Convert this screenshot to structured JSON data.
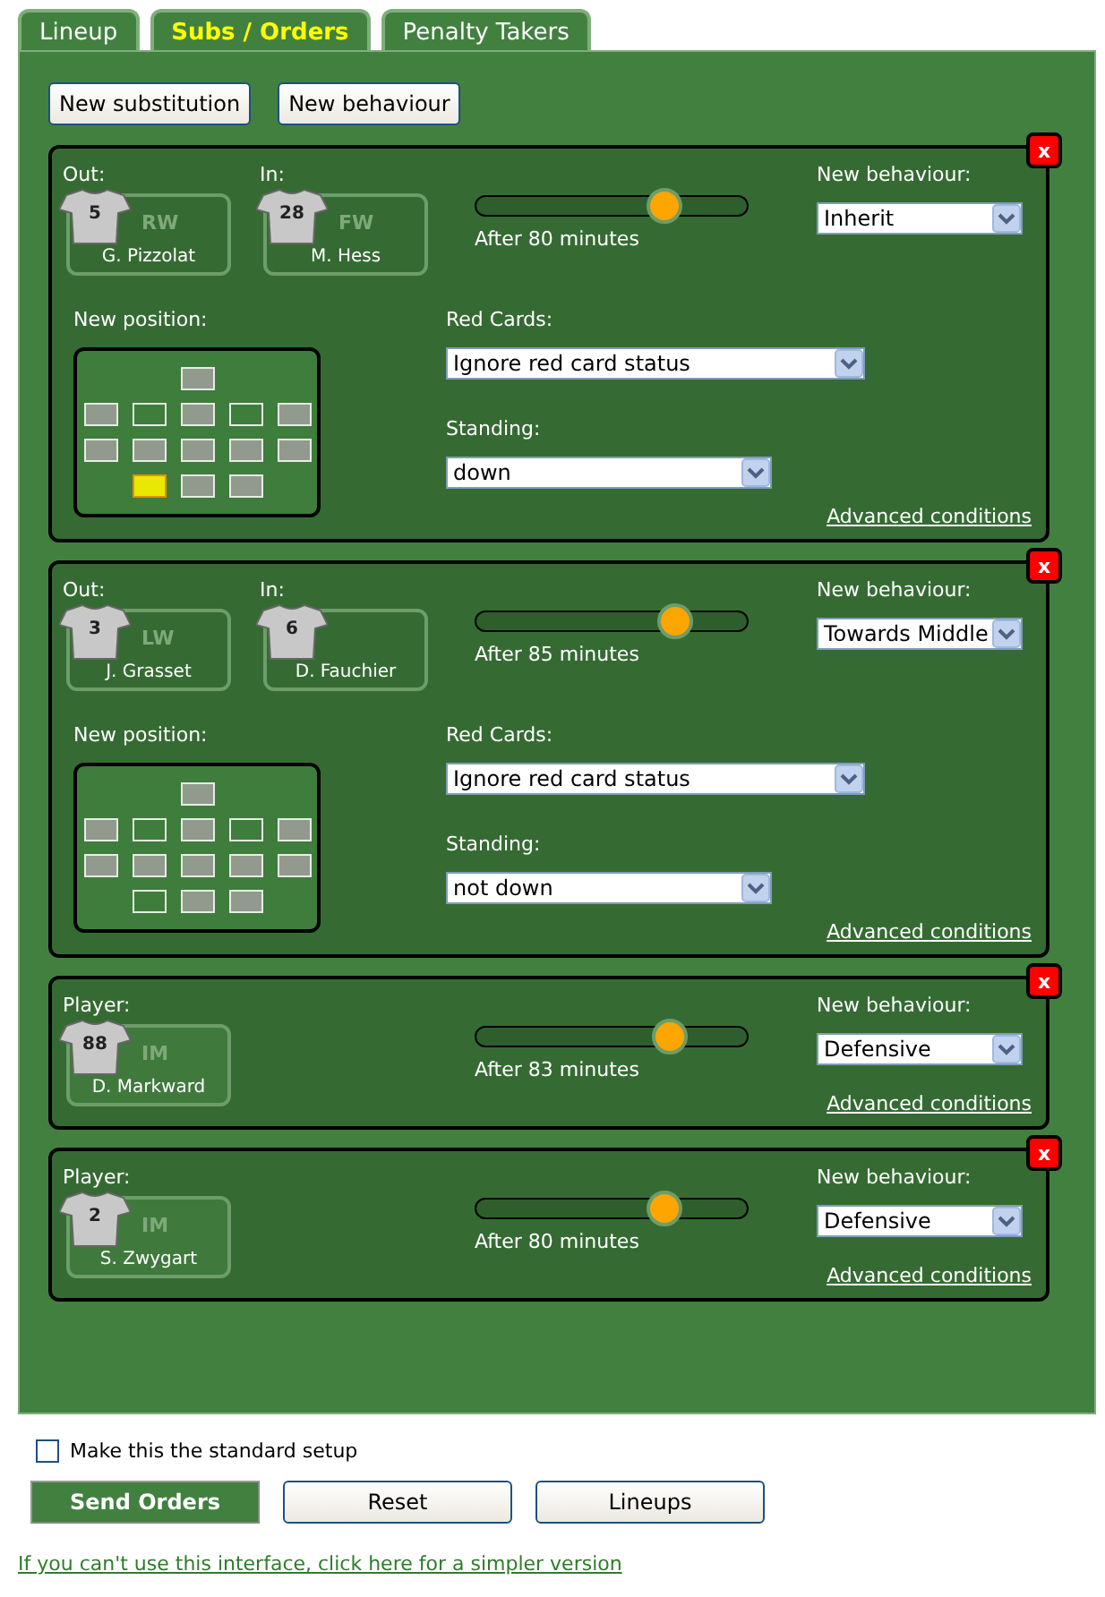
{
  "tabs": [
    {
      "label": "Lineup",
      "selected": false
    },
    {
      "label": "Subs / Orders",
      "selected": true
    },
    {
      "label": "Penalty Takers",
      "selected": false
    }
  ],
  "actions": [
    "New substitution",
    "New behaviour"
  ],
  "orders": [
    {
      "kind": "substitution",
      "out_label": "Out:",
      "in_label": "In:",
      "out": {
        "number": "5",
        "position": "RW",
        "name": "G. Pizzolat"
      },
      "in": {
        "number": "28",
        "position": "FW",
        "name": "M. Hess"
      },
      "level": 0.69,
      "minutes": "After 80 minutes",
      "behaviour_label": "New behaviour:",
      "behaviour": "Inherit",
      "position_label": "New position:",
      "formation": [
        [
          {
            "occupied": true,
            "selected": false
          }
        ],
        [
          {
            "occupied": true,
            "selected": false
          },
          {
            "occupied": false,
            "selected": false
          },
          {
            "occupied": true,
            "selected": false
          },
          {
            "occupied": false,
            "selected": false
          },
          {
            "occupied": true,
            "selected": false
          }
        ],
        [
          {
            "occupied": true,
            "selected": false
          },
          {
            "occupied": true,
            "selected": false
          },
          {
            "occupied": true,
            "selected": false
          },
          {
            "occupied": true,
            "selected": false
          },
          {
            "occupied": true,
            "selected": false
          }
        ],
        [
          {
            "occupied": true,
            "selected": true
          },
          {
            "occupied": true,
            "selected": false
          },
          {
            "occupied": true,
            "selected": false
          }
        ]
      ],
      "red_cards_label": "Red Cards:",
      "red_cards": "Ignore red card status",
      "standing_label": "Standing:",
      "standing": "down",
      "advanced": "Advanced conditions",
      "close": "x"
    },
    {
      "kind": "substitution",
      "out_label": "Out:",
      "in_label": "In:",
      "out": {
        "number": "3",
        "position": "LW",
        "name": "J. Grasset"
      },
      "in": {
        "number": "6",
        "name": "D. Fauchier"
      },
      "level": 0.73,
      "minutes": "After 85 minutes",
      "behaviour_label": "New behaviour:",
      "behaviour": "Towards Middle",
      "position_label": "New position:",
      "formation": [
        [
          {
            "occupied": true,
            "selected": false
          }
        ],
        [
          {
            "occupied": true,
            "selected": false
          },
          {
            "occupied": false,
            "selected": false
          },
          {
            "occupied": true,
            "selected": false
          },
          {
            "occupied": false,
            "selected": false
          },
          {
            "occupied": true,
            "selected": false
          }
        ],
        [
          {
            "occupied": true,
            "selected": false
          },
          {
            "occupied": true,
            "selected": false
          },
          {
            "occupied": true,
            "selected": false
          },
          {
            "occupied": true,
            "selected": false
          },
          {
            "occupied": true,
            "selected": false
          }
        ],
        [
          {
            "occupied": false,
            "selected": false
          },
          {
            "occupied": true,
            "selected": false
          },
          {
            "occupied": true,
            "selected": false
          }
        ]
      ],
      "red_cards_label": "Red Cards:",
      "red_cards": "Ignore red card status",
      "standing_label": "Standing:",
      "standing": "not down",
      "advanced": "Advanced conditions",
      "close": "x"
    },
    {
      "kind": "behaviour",
      "player_label": "Player:",
      "player": {
        "number": "88",
        "position": "IM",
        "name": "D. Markward"
      },
      "level": 0.71,
      "minutes": "After 83 minutes",
      "behaviour_label": "New behaviour:",
      "behaviour": "Defensive",
      "advanced": "Advanced conditions",
      "close": "x"
    },
    {
      "kind": "behaviour",
      "player_label": "Player:",
      "player": {
        "number": "2",
        "position": "IM",
        "name": "S. Zwygart"
      },
      "level": 0.69,
      "minutes": "After 80 minutes",
      "behaviour_label": "New behaviour:",
      "behaviour": "Defensive",
      "advanced": "Advanced conditions",
      "close": "x"
    }
  ],
  "standard_setup": {
    "label": "Make this the standard setup",
    "checked": false
  },
  "buttons": [
    {
      "label": "Send Orders",
      "kind": "primary"
    },
    {
      "label": "Reset",
      "kind": "plain"
    },
    {
      "label": "Lineups",
      "kind": "plain"
    }
  ],
  "simpler_link": "If you can't use this interface, click here for a simpler version"
}
